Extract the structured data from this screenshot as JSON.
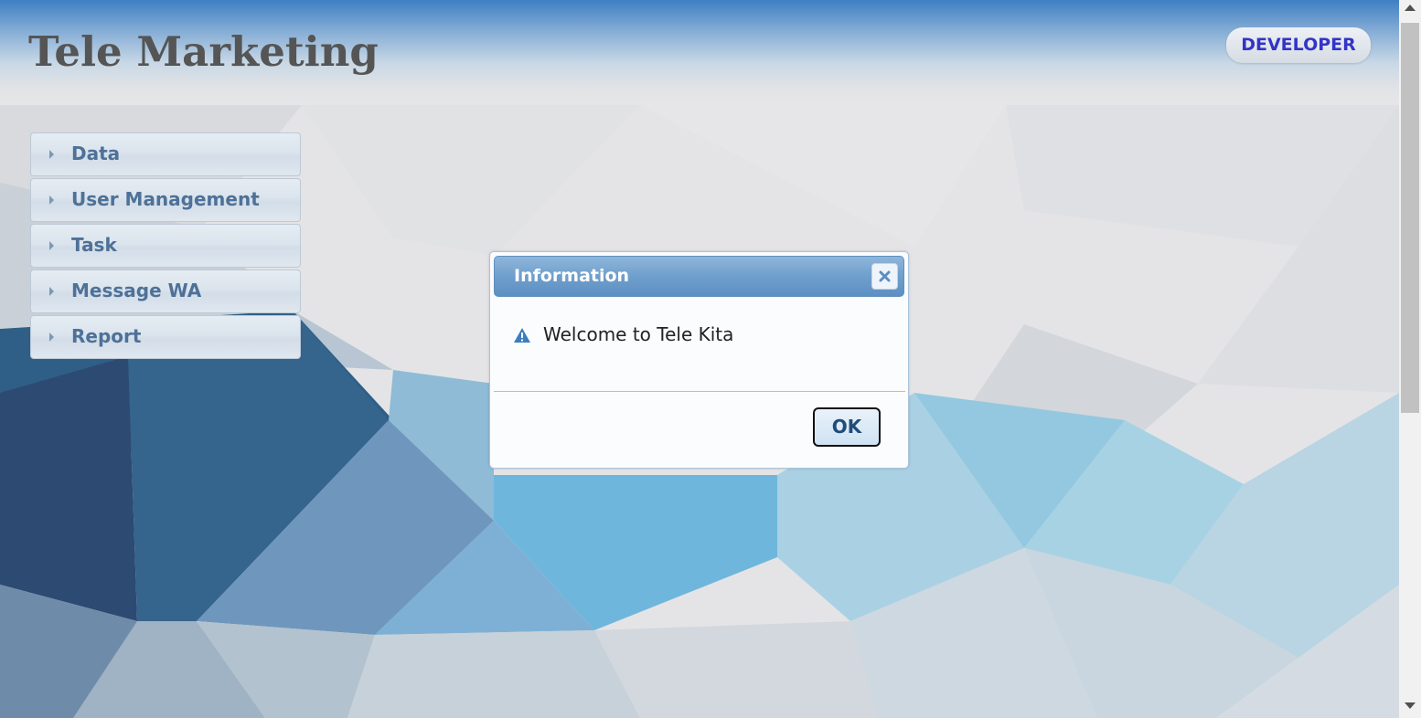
{
  "header": {
    "title": "Tele Marketing",
    "user_role": "DEVELOPER"
  },
  "sidebar": {
    "items": [
      {
        "label": "Data"
      },
      {
        "label": "User Management"
      },
      {
        "label": "Task"
      },
      {
        "label": "Message WA"
      },
      {
        "label": "Report"
      }
    ]
  },
  "dialog": {
    "title": "Information",
    "message": "Welcome to Tele Kita",
    "ok_label": "OK",
    "icons": {
      "close": "close-icon",
      "message": "warning-icon"
    }
  },
  "colors": {
    "header_top": "#3e7fc3",
    "title_text": "#555555",
    "role_text": "#3434c8",
    "accordion_text": "#4e7198",
    "dialog_titlebar": "#6f9fcc"
  }
}
